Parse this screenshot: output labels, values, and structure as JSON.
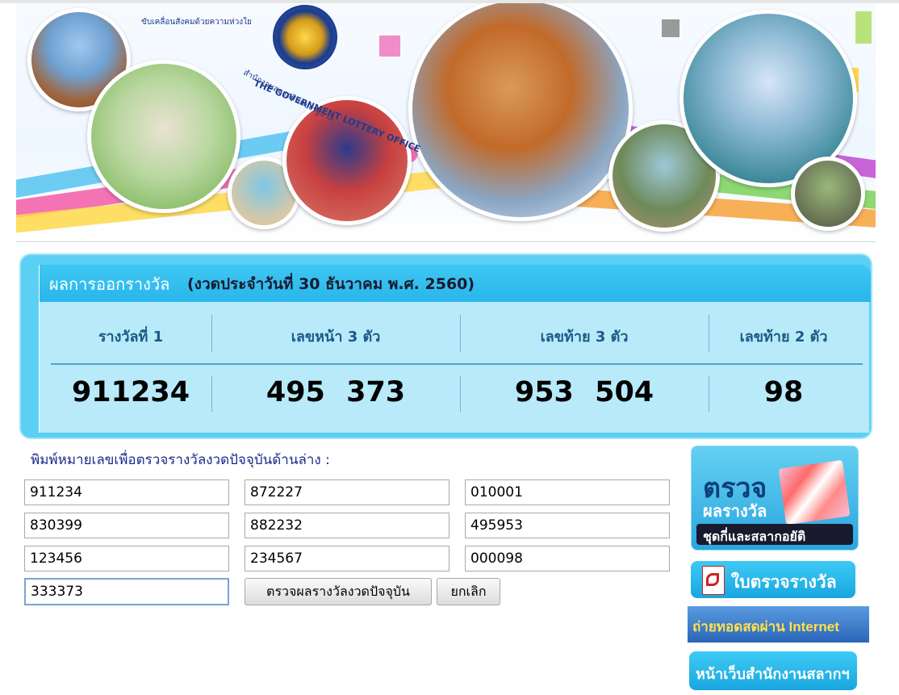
{
  "banner": {
    "thanks_text": "ขับเคลื่อนสังคมด้วยความห่วงใย",
    "org_th": "สำนักงานสลากกินแบ่งรัฐบาล",
    "org_en": "THE GOVERNMENT LOTTERY OFFICE"
  },
  "results": {
    "title": "ผลการออกรางวัล",
    "draw_date": "(งวดประจำวันที่ 30 ธันวาคม พ.ศ. 2560)",
    "columns": [
      {
        "label": "รางวัลที่ 1",
        "value": "911234"
      },
      {
        "label": "เลขหน้า 3 ตัว",
        "value": "495 373"
      },
      {
        "label": "เลขท้าย 3 ตัว",
        "value": "953 504"
      },
      {
        "label": "เลขท้าย 2 ตัว",
        "value": "98"
      }
    ]
  },
  "form": {
    "prompt": "พิมพ์หมายเลขเพื่อตรวจรางวัลงวดปัจจุบันด้านล่าง :",
    "inputs": [
      "911234",
      "872227",
      "010001",
      "830399",
      "882232",
      "495953",
      "123456",
      "234567",
      "000098",
      "333373"
    ],
    "check_button": "ตรวจผลรางวัลงวดปัจจุบัน",
    "cancel_button": "ยกเลิก"
  },
  "sidebar": {
    "check_set_title": "ตรวจ",
    "check_set_sub": "ผลรางวัล",
    "check_set_line3": "ชุดกี่และสลากอยัติ",
    "pdf_button": "ใบตรวจรางวัล",
    "live_button": "ถ่ายทอดสดผ่าน Internet",
    "home_button": "หน้าเว็บสำนักงานสลากฯ"
  },
  "colors": {
    "panel_blue": "#5ccff4",
    "panel_body": "#b8eaf9",
    "header_text": "#1c5a86",
    "prompt_text": "#1a2c8c"
  }
}
